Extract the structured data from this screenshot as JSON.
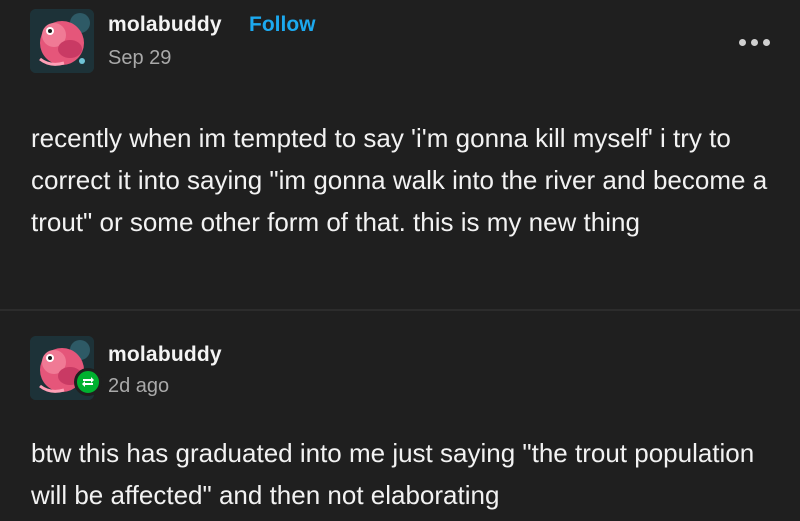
{
  "posts": [
    {
      "username": "molabuddy",
      "follow_label": "Follow",
      "timestamp": "Sep 29",
      "more_icon": "more-horizontal-icon",
      "body": "recently when im tempted to say 'i'm gonna kill myself' i try to correct it into saying \"im gonna walk into the river and become a trout\" or some other form of that. this is my new thing"
    },
    {
      "username": "molabuddy",
      "timestamp": "2d ago",
      "badge_icon": "reblog-icon",
      "body": "btw this has graduated into me just saying \"the trout population will be affected\" and then not elaborating"
    }
  ],
  "colors": {
    "background": "#1f1f1f",
    "text": "#f2f2f2",
    "muted": "#a9a9a9",
    "follow": "#1ca9ef",
    "reblog_badge": "#00b12f"
  }
}
